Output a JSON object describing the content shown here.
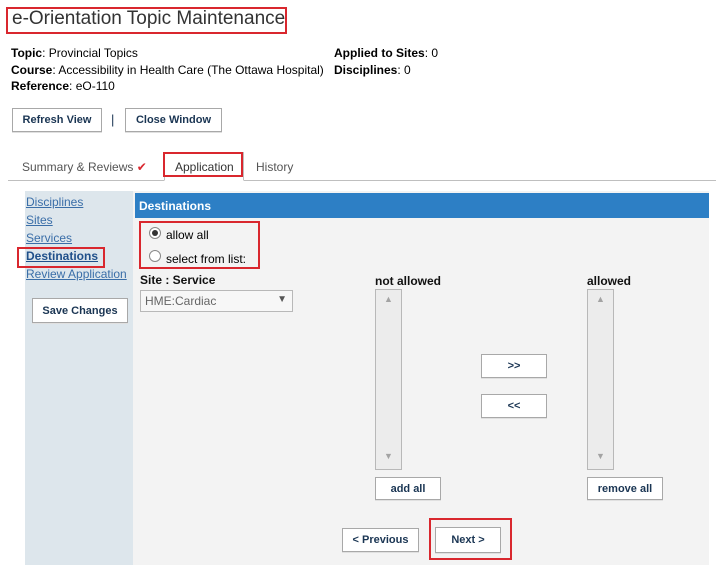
{
  "page": {
    "title": "e-Orientation Topic Maintenance"
  },
  "meta": {
    "topic_label": "Topic",
    "topic_value": "Provincial Topics",
    "course_label": "Course",
    "course_value": "Accessibility in Health Care (The Ottawa Hospital)",
    "reference_label": "Reference",
    "reference_value": "eO-110",
    "sites_label": "Applied to Sites",
    "sites_value": "0",
    "disciplines_label": "Disciplines",
    "disciplines_value": "0"
  },
  "toolbar": {
    "refresh_label": "Refresh View",
    "separator": "|",
    "close_label": "Close Window"
  },
  "tabs": [
    {
      "label": "Summary & Reviews",
      "check": "✔"
    },
    {
      "label": "Application"
    },
    {
      "label": "History"
    }
  ],
  "sidenav": {
    "items": [
      "Disciplines",
      "Sites",
      "Services",
      "Destinations",
      "Review Application"
    ],
    "save_label": "Save Changes"
  },
  "destinations": {
    "header": "Destinations",
    "option_all": "allow all",
    "option_list": "select from list:",
    "site_service_label": "Site : Service",
    "site_service_value": "HME:Cardiac",
    "not_allowed_label": "not allowed",
    "allowed_label": "allowed",
    "move_right_label": ">>",
    "move_left_label": "<<",
    "add_all_label": "add all",
    "remove_all_label": "remove all"
  },
  "nav_buttons": {
    "previous_label": "< Previous",
    "next_label": "Next >"
  },
  "colors": {
    "accent_blue": "#2d7fc5",
    "highlight_red": "#d9272e",
    "link_blue": "#3a6ea8",
    "check_red": "#d9272e"
  }
}
